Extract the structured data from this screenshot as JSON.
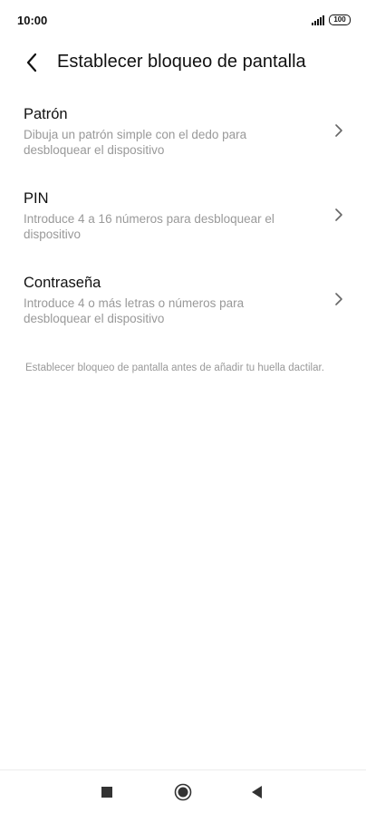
{
  "status_bar": {
    "time": "10:00",
    "battery": "100"
  },
  "header": {
    "back_icon": "chevron-left-icon",
    "title": "Establecer bloqueo de pantalla"
  },
  "options": [
    {
      "title": "Patrón",
      "description": "Dibuja un patrón simple con el dedo para desbloquear el dispositivo"
    },
    {
      "title": "PIN",
      "description": "Introduce 4 a 16 números para desbloquear el dispositivo"
    },
    {
      "title": "Contraseña",
      "description": "Introduce 4 o más letras o números para desbloquear el dispositivo"
    }
  ],
  "hint": "Establecer bloqueo de pantalla antes de añadir tu huella dactilar.",
  "nav_bar": {
    "recents_icon": "square-icon",
    "home_icon": "circle-icon",
    "back_icon": "triangle-back-icon"
  },
  "colors": {
    "text_primary": "#111111",
    "text_secondary": "#999999",
    "background": "#ffffff"
  }
}
